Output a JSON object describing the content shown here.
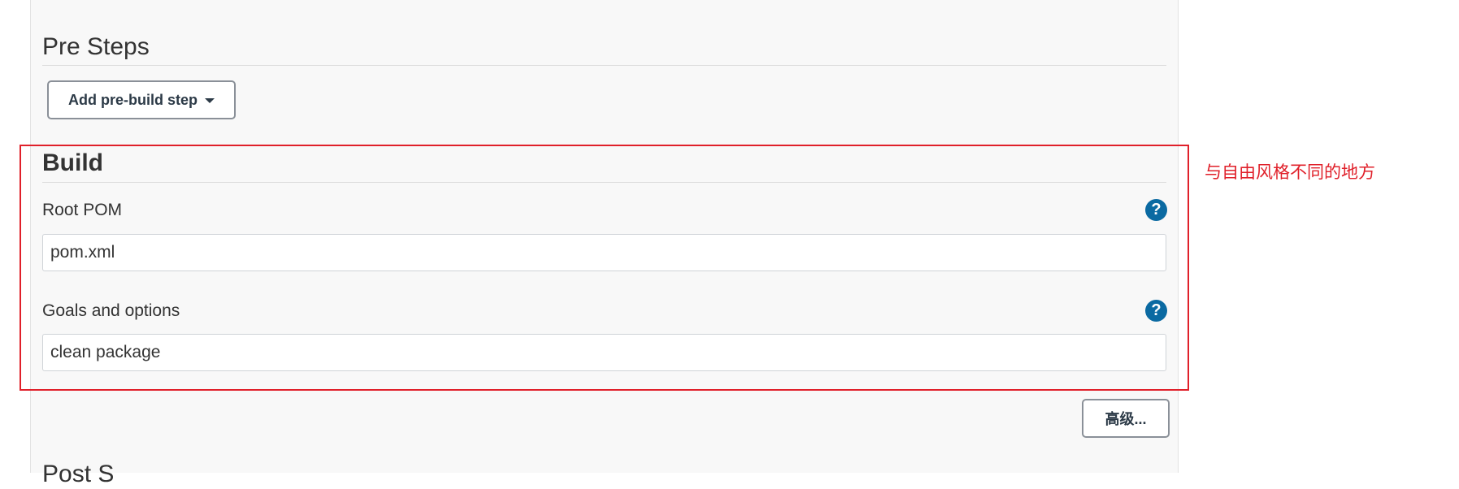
{
  "pre_steps": {
    "title": "Pre Steps",
    "add_button_label": "Add pre-build step"
  },
  "build": {
    "title": "Build",
    "root_pom": {
      "label": "Root POM",
      "value": "pom.xml"
    },
    "goals": {
      "label": "Goals and options",
      "value": "clean package"
    },
    "advanced_button_label": "高级..."
  },
  "next_section": {
    "title_partial": "Post S"
  },
  "annotation": {
    "text": "与自由风格不同的地方",
    "color": "#e0202a"
  },
  "icons": {
    "help": "?"
  },
  "colors": {
    "help_icon": "#0b6aa2",
    "panel_background": "#f8f8f8"
  }
}
